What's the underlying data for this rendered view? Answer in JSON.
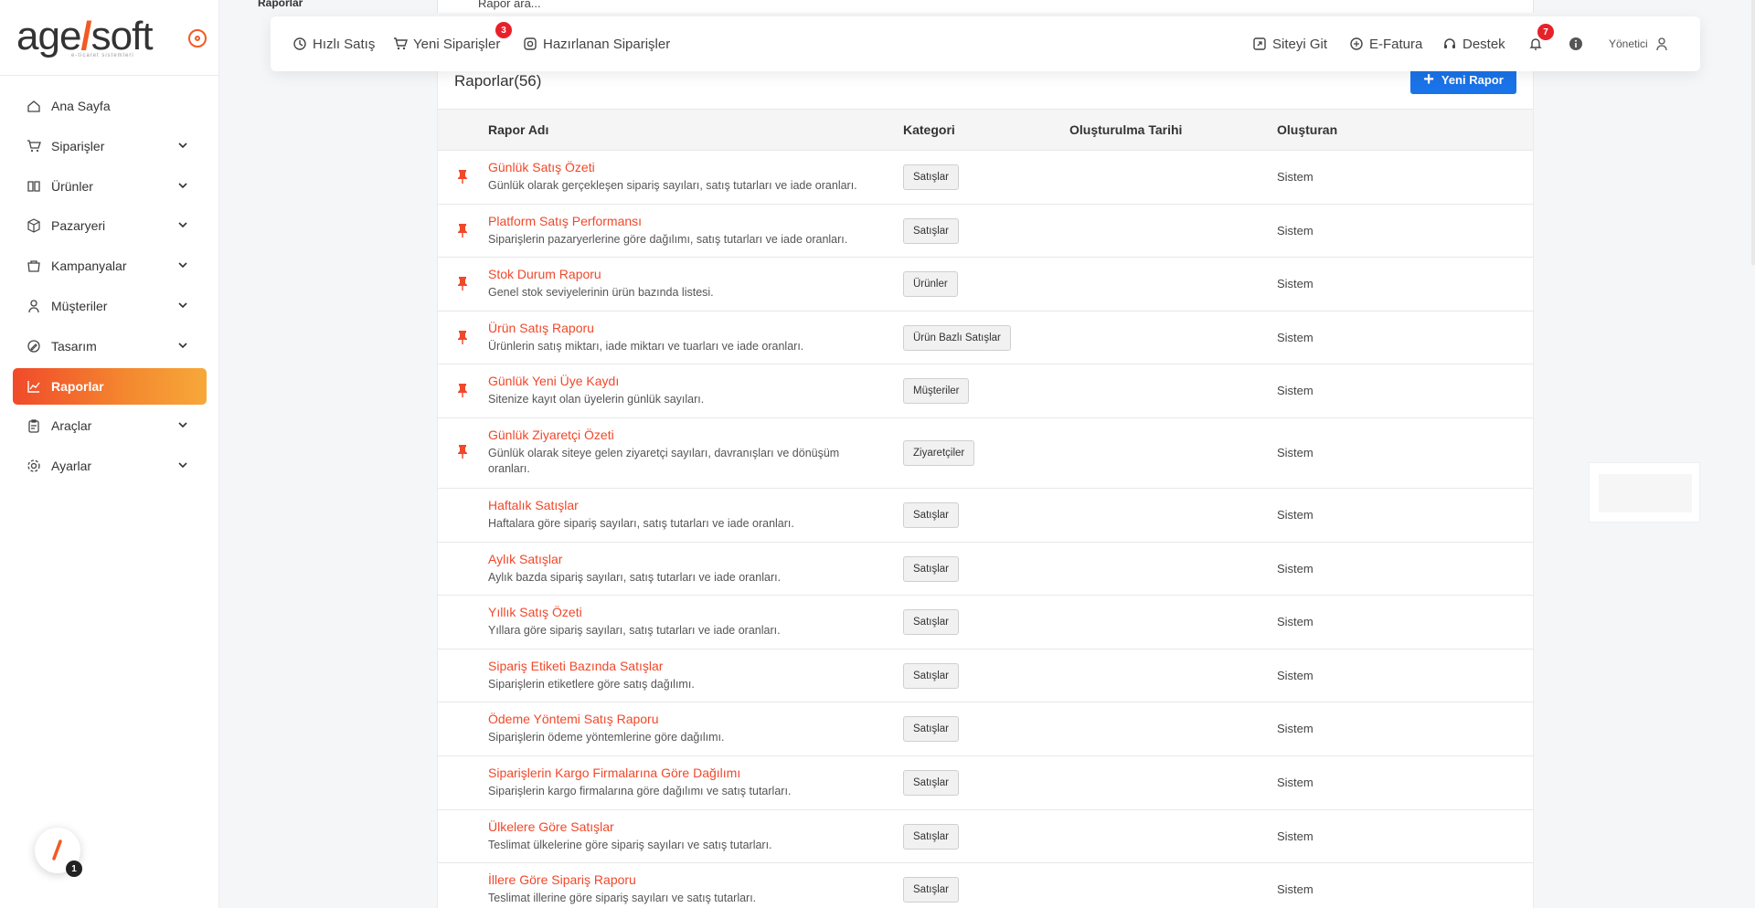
{
  "brand": {
    "name_part1": "age",
    "name_part2": "soft",
    "tagline": "e-ticaret sistemleri"
  },
  "breadcrumb": "Raporlar",
  "search": {
    "placeholder": "Rapor ara..."
  },
  "topbar": {
    "quick_sale": "Hızlı Satış",
    "new_orders": "Yeni Siparişler",
    "new_orders_count": "3",
    "preparing_orders": "Hazırlanan Siparişler",
    "visit_site": "Siteyi Git",
    "e_invoice": "E-Fatura",
    "support": "Destek",
    "notifications_count": "7",
    "user_role": "Yönetici"
  },
  "sidebar": {
    "items": [
      {
        "label": "Ana Sayfa",
        "icon": "home-icon",
        "expandable": false
      },
      {
        "label": "Siparişler",
        "icon": "cart-icon",
        "expandable": true
      },
      {
        "label": "Ürünler",
        "icon": "book-icon",
        "expandable": true
      },
      {
        "label": "Pazaryeri",
        "icon": "box-icon",
        "expandable": true
      },
      {
        "label": "Kampanyalar",
        "icon": "basket-icon",
        "expandable": true
      },
      {
        "label": "Müşteriler",
        "icon": "user-icon",
        "expandable": true
      },
      {
        "label": "Tasarım",
        "icon": "pen-icon",
        "expandable": true
      },
      {
        "label": "Raporlar",
        "icon": "chart-icon",
        "expandable": false,
        "active": true
      },
      {
        "label": "Araçlar",
        "icon": "clipboard-icon",
        "expandable": true
      },
      {
        "label": "Ayarlar",
        "icon": "gear-icon",
        "expandable": true
      }
    ],
    "bottom_badge_count": "1"
  },
  "reports": {
    "title": "Raporlar(56)",
    "new_button": "Yeni Rapor",
    "columns": {
      "name": "Rapor Adı",
      "category": "Kategori",
      "created_at": "Oluşturulma Tarihi",
      "created_by": "Oluşturan"
    },
    "rows": [
      {
        "title": "Günlük Satış Özeti",
        "desc": "Günlük olarak gerçekleşen sipariş sayıları, satış tutarları ve iade oranları.",
        "category": "Satışlar",
        "owner": "Sistem",
        "pinned": true
      },
      {
        "title": "Platform Satış Performansı",
        "desc": "Siparişlerin pazaryerlerine göre dağılımı, satış tutarları ve iade oranları.",
        "category": "Satışlar",
        "owner": "Sistem",
        "pinned": true
      },
      {
        "title": "Stok Durum Raporu",
        "desc": "Genel stok seviyelerinin ürün bazında listesi.",
        "category": "Ürünler",
        "owner": "Sistem",
        "pinned": true
      },
      {
        "title": "Ürün Satış Raporu",
        "desc": "Ürünlerin satış miktarı, iade miktarı ve tuarları ve iade oranları.",
        "category": "Ürün Bazlı Satışlar",
        "owner": "Sistem",
        "pinned": true
      },
      {
        "title": "Günlük Yeni Üye Kaydı",
        "desc": "Sitenize kayıt olan üyelerin günlük sayıları.",
        "category": "Müşteriler",
        "owner": "Sistem",
        "pinned": true
      },
      {
        "title": "Günlük Ziyaretçi Özeti",
        "desc": "Günlük olarak siteye gelen ziyaretçi sayıları, davranışları ve dönüşüm oranları.",
        "category": "Ziyaretçiler",
        "owner": "Sistem",
        "pinned": true
      },
      {
        "title": "Haftalık Satışlar",
        "desc": "Haftalara göre sipariş sayıları, satış tutarları ve iade oranları.",
        "category": "Satışlar",
        "owner": "Sistem",
        "pinned": false
      },
      {
        "title": "Aylık Satışlar",
        "desc": "Aylık bazda sipariş sayıları, satış tutarları ve iade oranları.",
        "category": "Satışlar",
        "owner": "Sistem",
        "pinned": false
      },
      {
        "title": "Yıllık Satış Özeti",
        "desc": "Yıllara göre sipariş sayıları, satış tutarları ve iade oranları.",
        "category": "Satışlar",
        "owner": "Sistem",
        "pinned": false
      },
      {
        "title": "Sipariş Etiketi Bazında Satışlar",
        "desc": "Siparişlerin etiketlere göre satış dağılımı.",
        "category": "Satışlar",
        "owner": "Sistem",
        "pinned": false
      },
      {
        "title": "Ödeme Yöntemi Satış Raporu",
        "desc": "Siparişlerin ödeme yöntemlerine göre dağılımı.",
        "category": "Satışlar",
        "owner": "Sistem",
        "pinned": false
      },
      {
        "title": "Siparişlerin Kargo Firmalarına Göre Dağılımı",
        "desc": "Siparişlerin kargo firmalarına göre dağılımı ve satış tutarları.",
        "category": "Satışlar",
        "owner": "Sistem",
        "pinned": false
      },
      {
        "title": "Ülkelere Göre Satışlar",
        "desc": "Teslimat ülkelerine göre sipariş sayıları ve satış tutarları.",
        "category": "Satışlar",
        "owner": "Sistem",
        "pinned": false
      },
      {
        "title": "İllere Göre Sipariş Raporu",
        "desc": "Teslimat illerine göre sipariş sayıları ve satış tutarları.",
        "category": "Satışlar",
        "owner": "Sistem",
        "pinned": false
      }
    ]
  },
  "colors": {
    "accent": "#f0482a",
    "primary_button": "#1a73e8",
    "badge": "#e8202a"
  }
}
